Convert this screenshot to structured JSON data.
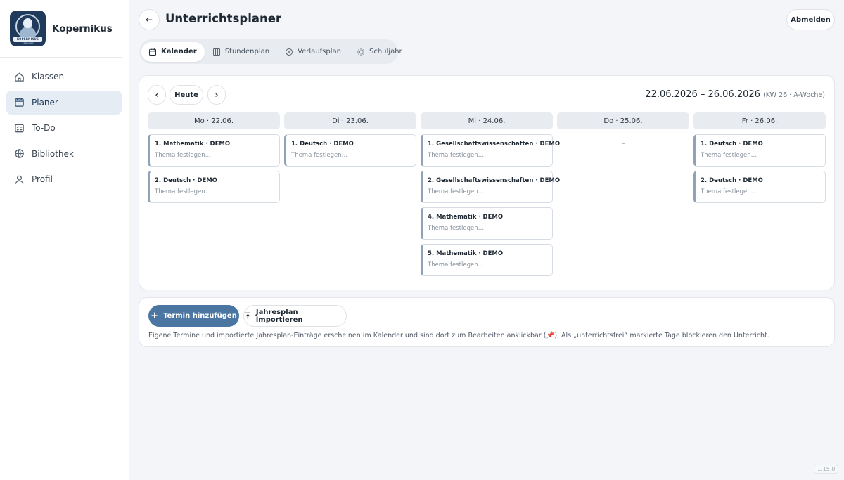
{
  "app": {
    "name": "Kopernikus",
    "logo_text": "KOPERNIKUS",
    "logo_sub": "LERNAPP",
    "version": "1.15.0"
  },
  "sidebar": {
    "items": [
      {
        "label": "Klassen",
        "icon": "home-icon",
        "active": false
      },
      {
        "label": "Planer",
        "icon": "calendar-icon",
        "active": true
      },
      {
        "label": "To-Do",
        "icon": "checklist-icon",
        "active": false
      },
      {
        "label": "Bibliothek",
        "icon": "globe-icon",
        "active": false
      },
      {
        "label": "Profil",
        "icon": "user-icon",
        "active": false
      }
    ]
  },
  "header": {
    "title": "Unterrichtsplaner",
    "logout_label": "Abmelden",
    "back_icon": "arrow-left-icon"
  },
  "tabs": [
    {
      "label": "Kalender",
      "icon": "calendar-icon",
      "active": true
    },
    {
      "label": "Stundenplan",
      "icon": "grid-icon",
      "active": false
    },
    {
      "label": "Verlaufsplan",
      "icon": "compass-icon",
      "active": false
    },
    {
      "label": "Schuljahr",
      "icon": "sun-icon",
      "active": false
    }
  ],
  "calendar": {
    "prev_label": "‹",
    "next_label": "›",
    "today_label": "Heute",
    "range": "22.06.2026 – 26.06.2026",
    "week_info": "(KW 26 · A-Woche)",
    "days": [
      {
        "label": "Mo · 22.06.",
        "lessons": [
          {
            "title": "1. Mathematik · DEMO",
            "topic": "Thema festlegen…"
          },
          {
            "title": "2. Deutsch · DEMO",
            "topic": "Thema festlegen…"
          }
        ]
      },
      {
        "label": "Di · 23.06.",
        "lessons": [
          {
            "title": "1. Deutsch · DEMO",
            "topic": "Thema festlegen…"
          }
        ]
      },
      {
        "label": "Mi · 24.06.",
        "lessons": [
          {
            "title": "1. Gesellschaftswissenschaften · DEMO",
            "topic": "Thema festlegen…"
          },
          {
            "title": "2. Gesellschaftswissenschaften · DEMO",
            "topic": "Thema festlegen…"
          },
          {
            "title": "4. Mathematik · DEMO",
            "topic": "Thema festlegen…"
          },
          {
            "title": "5. Mathematik · DEMO",
            "topic": "Thema festlegen…"
          }
        ]
      },
      {
        "label": "Do · 25.06.",
        "lessons": [],
        "empty_text": "–"
      },
      {
        "label": "Fr · 26.06.",
        "lessons": [
          {
            "title": "1. Deutsch · DEMO",
            "topic": "Thema festlegen…"
          },
          {
            "title": "2. Deutsch · DEMO",
            "topic": "Thema festlegen…"
          }
        ]
      }
    ]
  },
  "actions": {
    "add_label": "Termin hinzufügen",
    "import_label": "Jahresplan importieren",
    "hint": "Eigene Termine und importierte Jahresplan-Einträge erscheinen im Kalender und sind dort zum Bearbeiten anklickbar (📌). Als „unterrichtsfrei“ markierte Tage blockieren den Unterricht."
  },
  "colors": {
    "accent": "#4a76a1",
    "sidebar_active": "#e6ecf3",
    "lesson_border": "#8fa2b8"
  }
}
